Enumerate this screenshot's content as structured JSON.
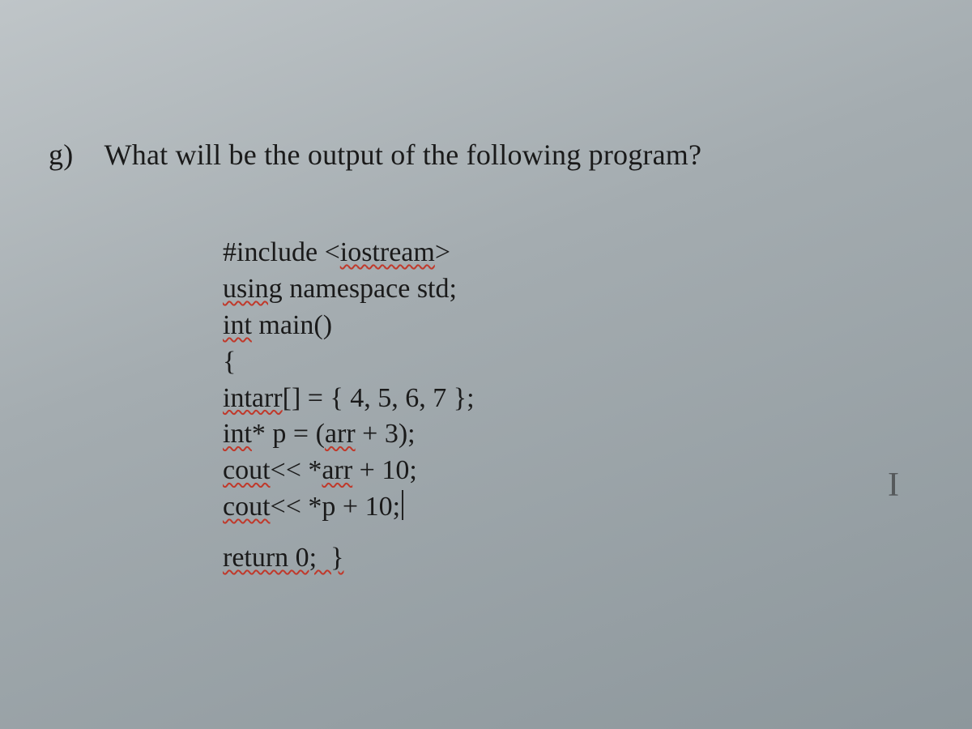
{
  "question": {
    "marker": "g)",
    "text": "What will be the output of the following program?"
  },
  "code": {
    "l1_a": "#include <",
    "l1_b": "iostream",
    "l1_c": ">",
    "l2_a": "using",
    "l2_b": " namespace std;",
    "l3_a": "int",
    "l3_b": " main()",
    "l4": "{",
    "l5_a": "intarr",
    "l5_b": "[] = { 4, 5, 6, 7 };",
    "l6_a": "int",
    "l6_b": "* p = (",
    "l6_c": "arr",
    "l6_d": " + 3);",
    "l7_a": "cout",
    "l7_b": "<< *",
    "l7_c": "arr",
    "l7_d": " + 10;",
    "l8_a": "cout",
    "l8_b": "<< *p + 10;",
    "l9": "return 0;  }"
  },
  "artifacts": {
    "ibeam": "I"
  }
}
